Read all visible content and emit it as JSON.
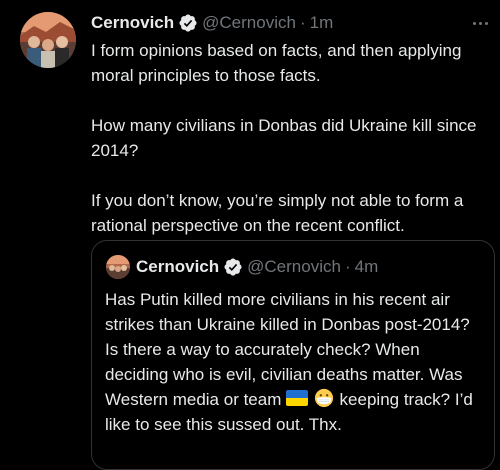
{
  "tweet": {
    "display_name": "Cernovich",
    "handle": "@Cernovich",
    "separator": "·",
    "time": "1m",
    "paragraphs": [
      "I form opinions based on facts, and then applying moral principles to those facts.",
      "How many civilians in Donbas did Ukraine kill since 2014?",
      "If you don’t know, you’re simply not able to form a rational perspective on the recent conflict."
    ]
  },
  "quote": {
    "display_name": "Cernovich",
    "handle": "@Cernovich",
    "separator": "·",
    "time": "4m",
    "text_before_emoji": "Has Putin killed more civilians in his recent air strikes than Ukraine killed in Donbas post-2014? Is there a way to accurately check? When deciding who is evil, civilian deaths matter. Was Western media or team ",
    "text_after_emoji": " keeping track? I’d like to see this sussed out. Thx."
  },
  "icons": {
    "verified": "verified-badge-icon",
    "more": "more-options-icon",
    "flag": "ukraine-flag-emoji",
    "mask": "face-with-medical-mask-emoji"
  },
  "colors": {
    "background": "#000000",
    "text": "#e7e9ea",
    "secondary": "#71767b",
    "border": "#2f3336",
    "verified": "#1d9bf0"
  }
}
